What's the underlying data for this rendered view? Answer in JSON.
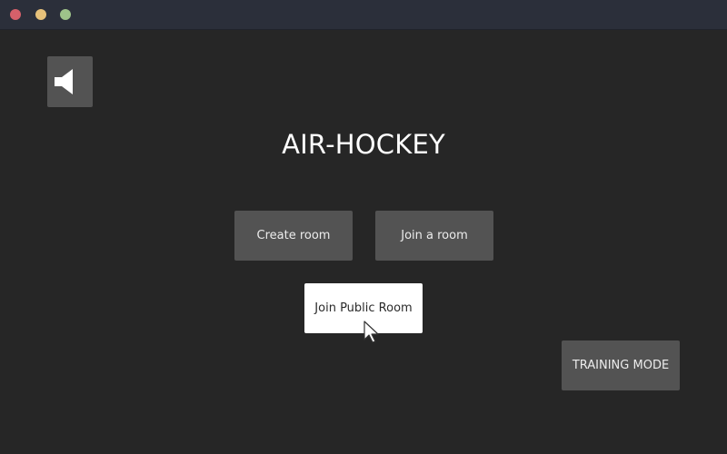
{
  "window": {
    "controls": [
      "close",
      "minimize",
      "maximize"
    ],
    "colors": {
      "close": "#d5606a",
      "minimize": "#e6c17a",
      "maximize": "#9ec38a"
    }
  },
  "sound": {
    "icon": "speaker-icon"
  },
  "game": {
    "title": "AIR-HOCKEY"
  },
  "menu": {
    "create_room": "Create room",
    "join_room": "Join a room",
    "join_public_room": "Join Public Room",
    "training_mode": "TRAINING MODE"
  },
  "colors": {
    "background": "#262626",
    "button": "#535353",
    "button_active": "#ffffff"
  }
}
